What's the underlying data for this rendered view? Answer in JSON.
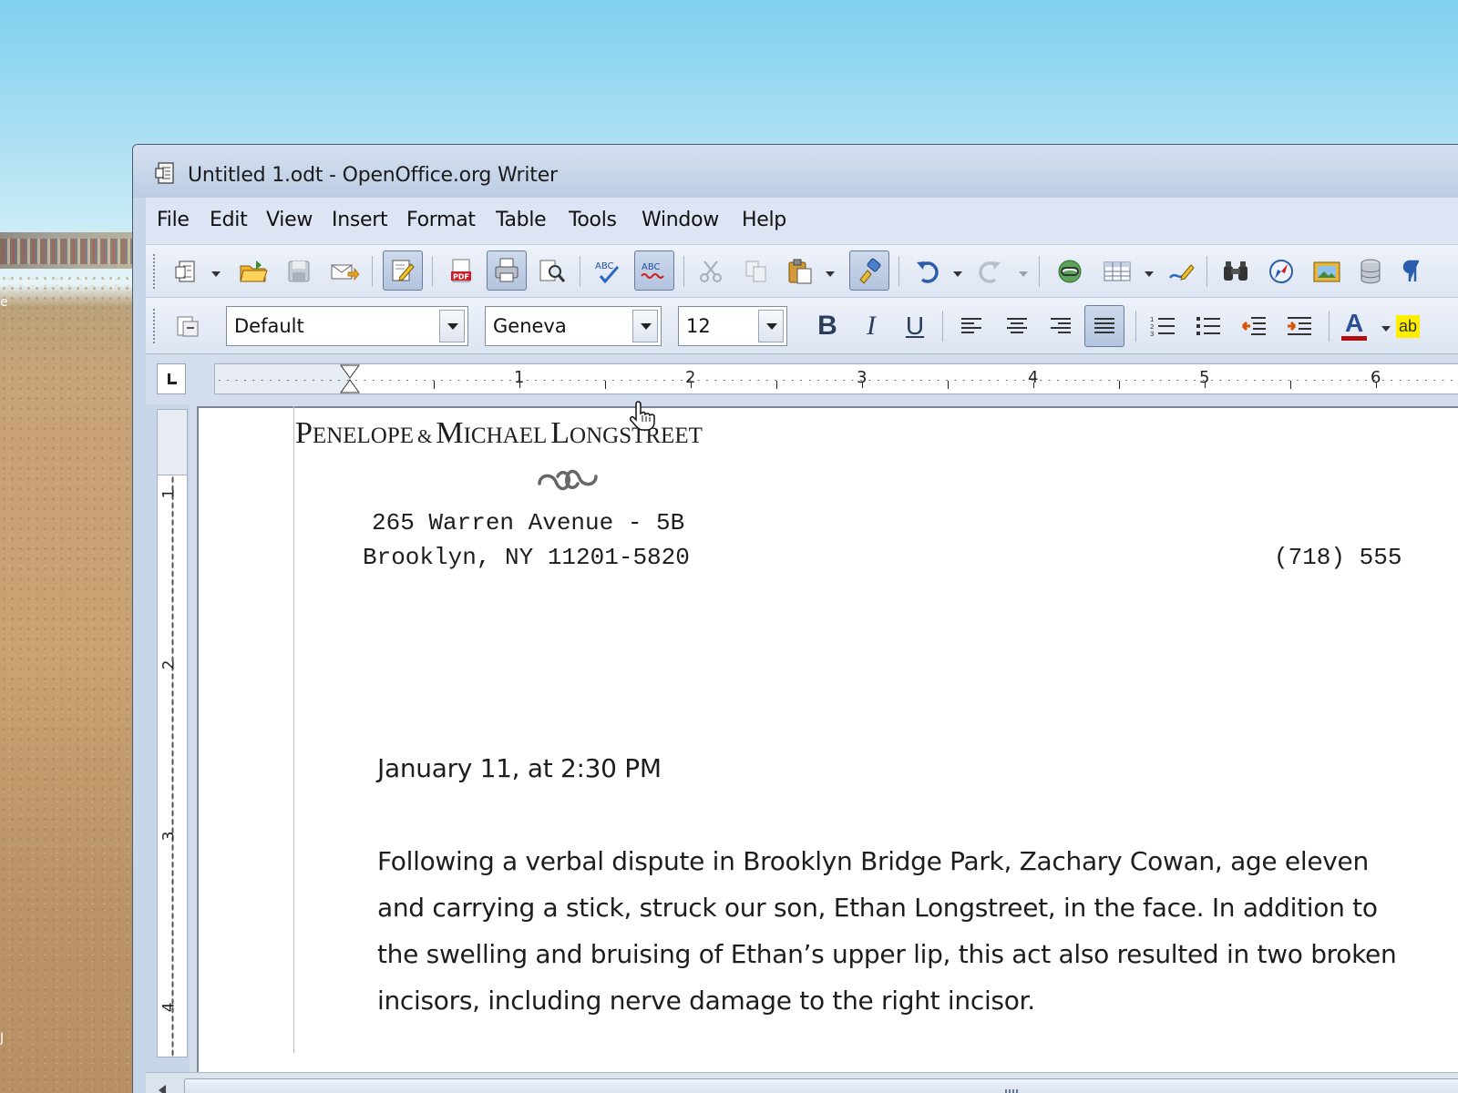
{
  "desktop": {
    "edge_text_top": "e",
    "edge_text_bottom": "J"
  },
  "window": {
    "title": "Untitled 1.odt - OpenOffice.org Writer"
  },
  "menu": [
    "File",
    "Edit",
    "View",
    "Insert",
    "Format",
    "Table",
    "Tools",
    "Window",
    "Help"
  ],
  "toolbar_standard": {
    "icons": [
      "new-document-icon",
      "open-folder-icon",
      "save-icon",
      "email-document-icon",
      "edit-file-icon",
      "export-pdf-icon",
      "print-icon",
      "page-preview-icon",
      "spellcheck-icon",
      "autospellcheck-icon",
      "cut-icon",
      "copy-icon",
      "paste-icon",
      "clone-formatting-icon",
      "undo-icon",
      "redo-icon",
      "hyperlink-icon",
      "table-icon",
      "draw-functions-icon",
      "find-replace-icon",
      "navigator-icon",
      "gallery-icon",
      "data-sources-icon",
      "formatting-marks-icon"
    ]
  },
  "toolbar_formatting": {
    "paragraph_style": "Default",
    "font_name": "Geneva",
    "font_size": "12",
    "bold_label": "B",
    "italic_label": "I",
    "underline_label": "U",
    "font_color_label": "A",
    "highlight_label": "ab"
  },
  "ruler": {
    "numbers": [
      "1",
      "2",
      "3",
      "4",
      "5",
      "6"
    ],
    "vertical_numbers": [
      "1",
      "2",
      "3",
      "4"
    ]
  },
  "document": {
    "letterhead": {
      "name1_initial": "P",
      "name1_rest": "ENELOPE",
      "amp": "&",
      "name2_initial": "M",
      "name2_rest": "ICHAEL",
      "surname_initial": "L",
      "surname_rest": "ONGSTREET"
    },
    "address_line1": "265 Warren Avenue - 5B",
    "address_line2": "Brooklyn, NY 11201-5820",
    "phone_partial": "(718) 555",
    "date_line": "January 11, at 2:30 PM",
    "paragraph_lines": [
      "Following a verbal dispute in Brooklyn Bridge Park, Zachary Cowan, age eleven",
      "and carrying a stick, struck our son, Ethan Longstreet, in the face. In addition to",
      "the swelling and bruising of Ethan’s upper lip, this act also resulted in two broken",
      "incisors, including nerve damage to the right incisor."
    ]
  },
  "colors": {
    "accent_pdf": "#c8202a",
    "font_color_bar": "#b01010",
    "highlight_yellow": "#ffee00"
  }
}
